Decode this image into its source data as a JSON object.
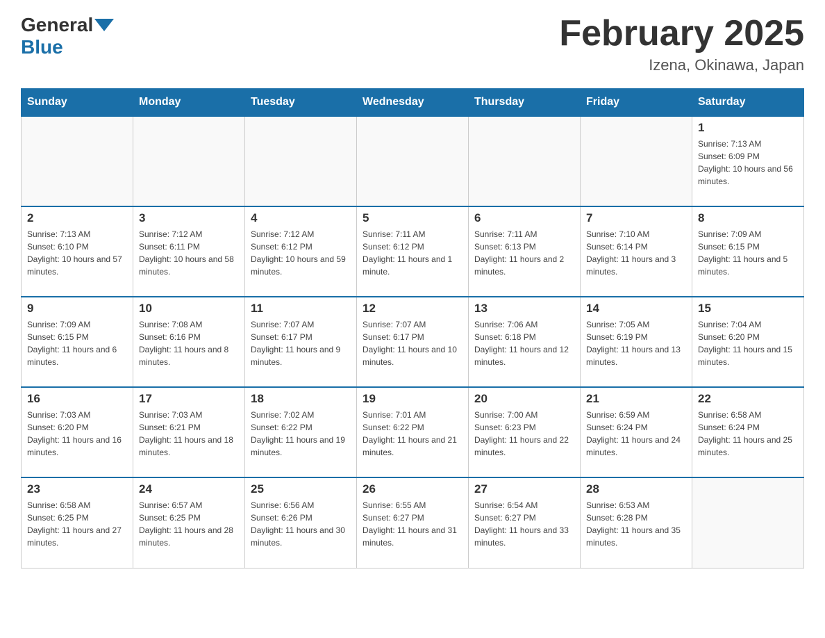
{
  "header": {
    "logo_general": "General",
    "logo_blue": "Blue",
    "month_title": "February 2025",
    "location": "Izena, Okinawa, Japan"
  },
  "weekdays": [
    "Sunday",
    "Monday",
    "Tuesday",
    "Wednesday",
    "Thursday",
    "Friday",
    "Saturday"
  ],
  "weeks": [
    [
      {
        "day": "",
        "sunrise": "",
        "sunset": "",
        "daylight": ""
      },
      {
        "day": "",
        "sunrise": "",
        "sunset": "",
        "daylight": ""
      },
      {
        "day": "",
        "sunrise": "",
        "sunset": "",
        "daylight": ""
      },
      {
        "day": "",
        "sunrise": "",
        "sunset": "",
        "daylight": ""
      },
      {
        "day": "",
        "sunrise": "",
        "sunset": "",
        "daylight": ""
      },
      {
        "day": "",
        "sunrise": "",
        "sunset": "",
        "daylight": ""
      },
      {
        "day": "1",
        "sunrise": "Sunrise: 7:13 AM",
        "sunset": "Sunset: 6:09 PM",
        "daylight": "Daylight: 10 hours and 56 minutes."
      }
    ],
    [
      {
        "day": "2",
        "sunrise": "Sunrise: 7:13 AM",
        "sunset": "Sunset: 6:10 PM",
        "daylight": "Daylight: 10 hours and 57 minutes."
      },
      {
        "day": "3",
        "sunrise": "Sunrise: 7:12 AM",
        "sunset": "Sunset: 6:11 PM",
        "daylight": "Daylight: 10 hours and 58 minutes."
      },
      {
        "day": "4",
        "sunrise": "Sunrise: 7:12 AM",
        "sunset": "Sunset: 6:12 PM",
        "daylight": "Daylight: 10 hours and 59 minutes."
      },
      {
        "day": "5",
        "sunrise": "Sunrise: 7:11 AM",
        "sunset": "Sunset: 6:12 PM",
        "daylight": "Daylight: 11 hours and 1 minute."
      },
      {
        "day": "6",
        "sunrise": "Sunrise: 7:11 AM",
        "sunset": "Sunset: 6:13 PM",
        "daylight": "Daylight: 11 hours and 2 minutes."
      },
      {
        "day": "7",
        "sunrise": "Sunrise: 7:10 AM",
        "sunset": "Sunset: 6:14 PM",
        "daylight": "Daylight: 11 hours and 3 minutes."
      },
      {
        "day": "8",
        "sunrise": "Sunrise: 7:09 AM",
        "sunset": "Sunset: 6:15 PM",
        "daylight": "Daylight: 11 hours and 5 minutes."
      }
    ],
    [
      {
        "day": "9",
        "sunrise": "Sunrise: 7:09 AM",
        "sunset": "Sunset: 6:15 PM",
        "daylight": "Daylight: 11 hours and 6 minutes."
      },
      {
        "day": "10",
        "sunrise": "Sunrise: 7:08 AM",
        "sunset": "Sunset: 6:16 PM",
        "daylight": "Daylight: 11 hours and 8 minutes."
      },
      {
        "day": "11",
        "sunrise": "Sunrise: 7:07 AM",
        "sunset": "Sunset: 6:17 PM",
        "daylight": "Daylight: 11 hours and 9 minutes."
      },
      {
        "day": "12",
        "sunrise": "Sunrise: 7:07 AM",
        "sunset": "Sunset: 6:17 PM",
        "daylight": "Daylight: 11 hours and 10 minutes."
      },
      {
        "day": "13",
        "sunrise": "Sunrise: 7:06 AM",
        "sunset": "Sunset: 6:18 PM",
        "daylight": "Daylight: 11 hours and 12 minutes."
      },
      {
        "day": "14",
        "sunrise": "Sunrise: 7:05 AM",
        "sunset": "Sunset: 6:19 PM",
        "daylight": "Daylight: 11 hours and 13 minutes."
      },
      {
        "day": "15",
        "sunrise": "Sunrise: 7:04 AM",
        "sunset": "Sunset: 6:20 PM",
        "daylight": "Daylight: 11 hours and 15 minutes."
      }
    ],
    [
      {
        "day": "16",
        "sunrise": "Sunrise: 7:03 AM",
        "sunset": "Sunset: 6:20 PM",
        "daylight": "Daylight: 11 hours and 16 minutes."
      },
      {
        "day": "17",
        "sunrise": "Sunrise: 7:03 AM",
        "sunset": "Sunset: 6:21 PM",
        "daylight": "Daylight: 11 hours and 18 minutes."
      },
      {
        "day": "18",
        "sunrise": "Sunrise: 7:02 AM",
        "sunset": "Sunset: 6:22 PM",
        "daylight": "Daylight: 11 hours and 19 minutes."
      },
      {
        "day": "19",
        "sunrise": "Sunrise: 7:01 AM",
        "sunset": "Sunset: 6:22 PM",
        "daylight": "Daylight: 11 hours and 21 minutes."
      },
      {
        "day": "20",
        "sunrise": "Sunrise: 7:00 AM",
        "sunset": "Sunset: 6:23 PM",
        "daylight": "Daylight: 11 hours and 22 minutes."
      },
      {
        "day": "21",
        "sunrise": "Sunrise: 6:59 AM",
        "sunset": "Sunset: 6:24 PM",
        "daylight": "Daylight: 11 hours and 24 minutes."
      },
      {
        "day": "22",
        "sunrise": "Sunrise: 6:58 AM",
        "sunset": "Sunset: 6:24 PM",
        "daylight": "Daylight: 11 hours and 25 minutes."
      }
    ],
    [
      {
        "day": "23",
        "sunrise": "Sunrise: 6:58 AM",
        "sunset": "Sunset: 6:25 PM",
        "daylight": "Daylight: 11 hours and 27 minutes."
      },
      {
        "day": "24",
        "sunrise": "Sunrise: 6:57 AM",
        "sunset": "Sunset: 6:25 PM",
        "daylight": "Daylight: 11 hours and 28 minutes."
      },
      {
        "day": "25",
        "sunrise": "Sunrise: 6:56 AM",
        "sunset": "Sunset: 6:26 PM",
        "daylight": "Daylight: 11 hours and 30 minutes."
      },
      {
        "day": "26",
        "sunrise": "Sunrise: 6:55 AM",
        "sunset": "Sunset: 6:27 PM",
        "daylight": "Daylight: 11 hours and 31 minutes."
      },
      {
        "day": "27",
        "sunrise": "Sunrise: 6:54 AM",
        "sunset": "Sunset: 6:27 PM",
        "daylight": "Daylight: 11 hours and 33 minutes."
      },
      {
        "day": "28",
        "sunrise": "Sunrise: 6:53 AM",
        "sunset": "Sunset: 6:28 PM",
        "daylight": "Daylight: 11 hours and 35 minutes."
      },
      {
        "day": "",
        "sunrise": "",
        "sunset": "",
        "daylight": ""
      }
    ]
  ]
}
